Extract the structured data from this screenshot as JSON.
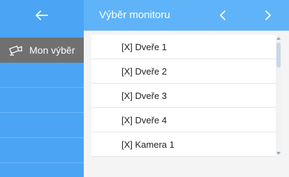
{
  "header": {
    "title": "Výběr monitoru",
    "back_icon": "arrow-left-icon",
    "prev_icon": "chevron-left-icon",
    "next_icon": "chevron-right-icon"
  },
  "sidebar": {
    "active_item": {
      "label": "Mon výběr",
      "icon": "monitor-camera-icon"
    }
  },
  "list": {
    "items": [
      {
        "label": "[X] Dveře 1"
      },
      {
        "label": "[X] Dveře 2"
      },
      {
        "label": "[X] Dveře 3"
      },
      {
        "label": "[X] Dveře 4"
      },
      {
        "label": "[X] Kamera 1"
      }
    ]
  },
  "colors": {
    "sidebar_blue": "#4ba4f4",
    "header_blue": "#5fb3f8",
    "active_gray": "#707070"
  }
}
